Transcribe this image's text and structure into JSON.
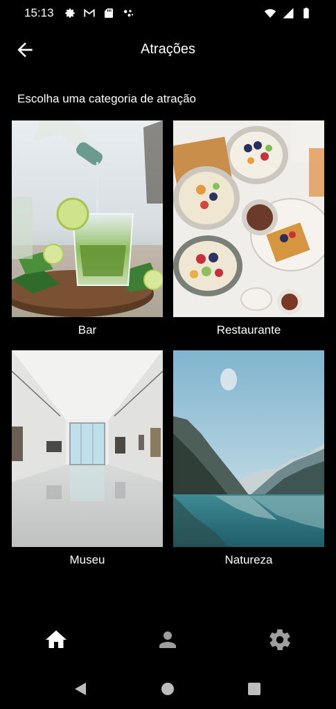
{
  "status_bar": {
    "time": "15:13",
    "left_icons": [
      "gear-icon",
      "gmail-icon",
      "sd-card-icon",
      "assistant-icon"
    ],
    "right_icons": [
      "wifi-icon",
      "signal-icon",
      "battery-icon"
    ]
  },
  "app_bar": {
    "title": "Atrações",
    "back_icon": "arrow-back-icon"
  },
  "subtitle": "Escolha uma categoria de atração",
  "categories": [
    {
      "label": "Bar"
    },
    {
      "label": "Restaurante"
    },
    {
      "label": "Museu"
    },
    {
      "label": "Natureza"
    }
  ],
  "bottom_nav": {
    "items": [
      "home-icon",
      "person-icon",
      "settings-icon"
    ],
    "active_color": "#ffffff",
    "inactive_color": "#9e9e9e"
  },
  "system_nav": [
    "back-triangle-icon",
    "home-circle-icon",
    "recents-square-icon"
  ]
}
